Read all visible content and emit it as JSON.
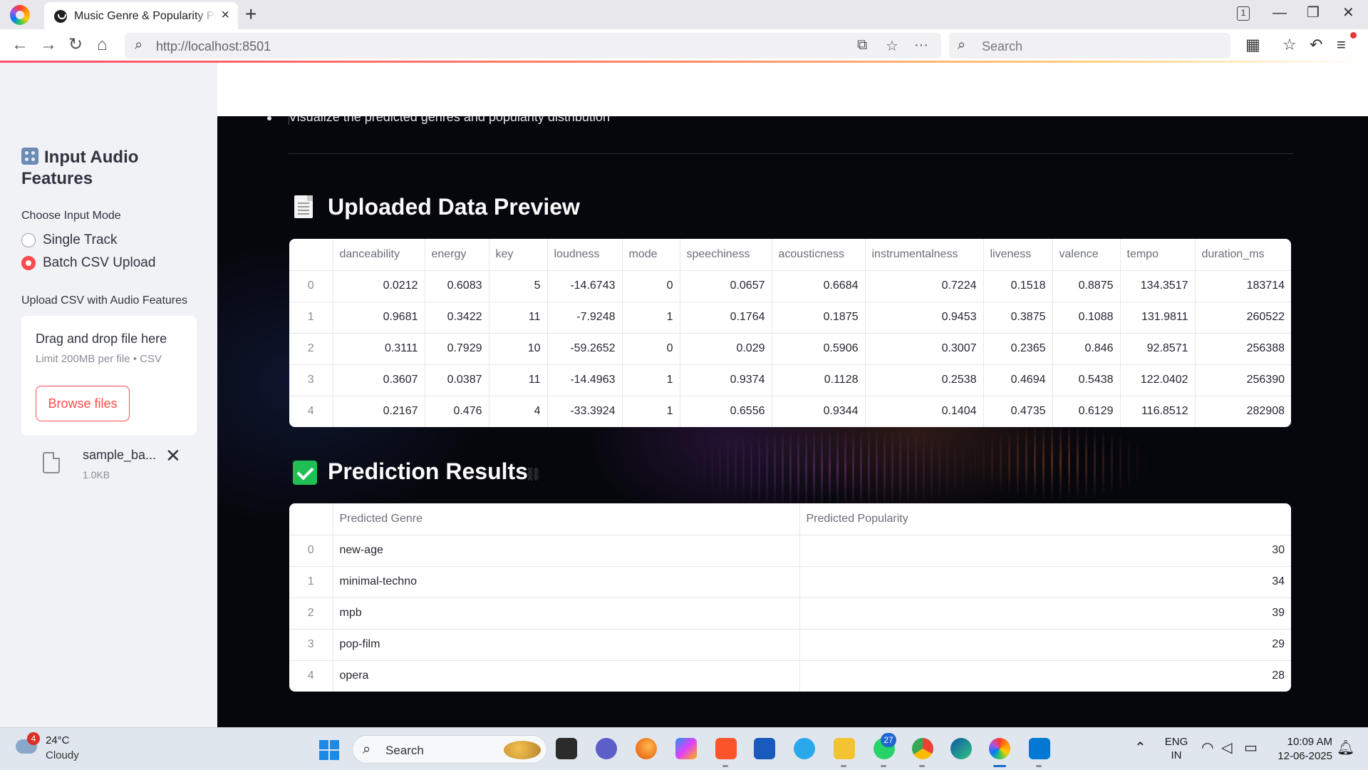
{
  "browser": {
    "tab_title": "Music Genre & Popularity Prediction",
    "tab_count": "1",
    "url": "http://localhost:8501",
    "search_placeholder": "Search"
  },
  "sidebar": {
    "title": "Input Audio Features",
    "mode_label": "Choose Input Mode",
    "modes": [
      {
        "label": "Single Track",
        "selected": false
      },
      {
        "label": "Batch CSV Upload",
        "selected": true
      }
    ],
    "upload_label": "Upload CSV with Audio Features",
    "dropzone_title": "Drag and drop file here",
    "dropzone_sub": "Limit 200MB per file • CSV",
    "browse_label": "Browse files",
    "file_name": "sample_ba...",
    "file_size": "1.0KB"
  },
  "main": {
    "cut_line": "Visualize the predicted genres and popularity distribution",
    "preview_heading": "Uploaded Data Preview",
    "preview_table": {
      "columns": [
        "",
        "danceability",
        "energy",
        "key",
        "loudness",
        "mode",
        "speechiness",
        "acousticness",
        "instrumentalness",
        "liveness",
        "valence",
        "tempo",
        "duration_ms"
      ],
      "rows": [
        [
          "0",
          "0.0212",
          "0.6083",
          "5",
          "-14.6743",
          "0",
          "0.0657",
          "0.6684",
          "0.7224",
          "0.1518",
          "0.8875",
          "134.3517",
          "183714"
        ],
        [
          "1",
          "0.9681",
          "0.3422",
          "11",
          "-7.9248",
          "1",
          "0.1764",
          "0.1875",
          "0.9453",
          "0.3875",
          "0.1088",
          "131.9811",
          "260522"
        ],
        [
          "2",
          "0.3111",
          "0.7929",
          "10",
          "-59.2652",
          "0",
          "0.029",
          "0.5906",
          "0.3007",
          "0.2365",
          "0.846",
          "92.8571",
          "256388"
        ],
        [
          "3",
          "0.3607",
          "0.0387",
          "11",
          "-14.4963",
          "1",
          "0.9374",
          "0.1128",
          "0.2538",
          "0.4694",
          "0.5438",
          "122.0402",
          "256390"
        ],
        [
          "4",
          "0.2167",
          "0.476",
          "4",
          "-33.3924",
          "1",
          "0.6556",
          "0.9344",
          "0.1404",
          "0.4735",
          "0.6129",
          "116.8512",
          "282908"
        ]
      ]
    },
    "results_heading": "Prediction Results",
    "results_table": {
      "columns": [
        "",
        "Predicted Genre",
        "Predicted Popularity"
      ],
      "rows": [
        [
          "0",
          "new-age",
          "30"
        ],
        [
          "1",
          "minimal-techno",
          "34"
        ],
        [
          "2",
          "mpb",
          "39"
        ],
        [
          "3",
          "pop-film",
          "29"
        ],
        [
          "4",
          "opera",
          "28"
        ]
      ]
    }
  },
  "taskbar": {
    "temperature": "24°C",
    "condition": "Cloudy",
    "weather_badge": "4",
    "search_label": "Search",
    "whatsapp_badge": "27",
    "lang_top": "ENG",
    "lang_bottom": "IN",
    "time": "10:09 AM",
    "date": "12-06-2025"
  }
}
